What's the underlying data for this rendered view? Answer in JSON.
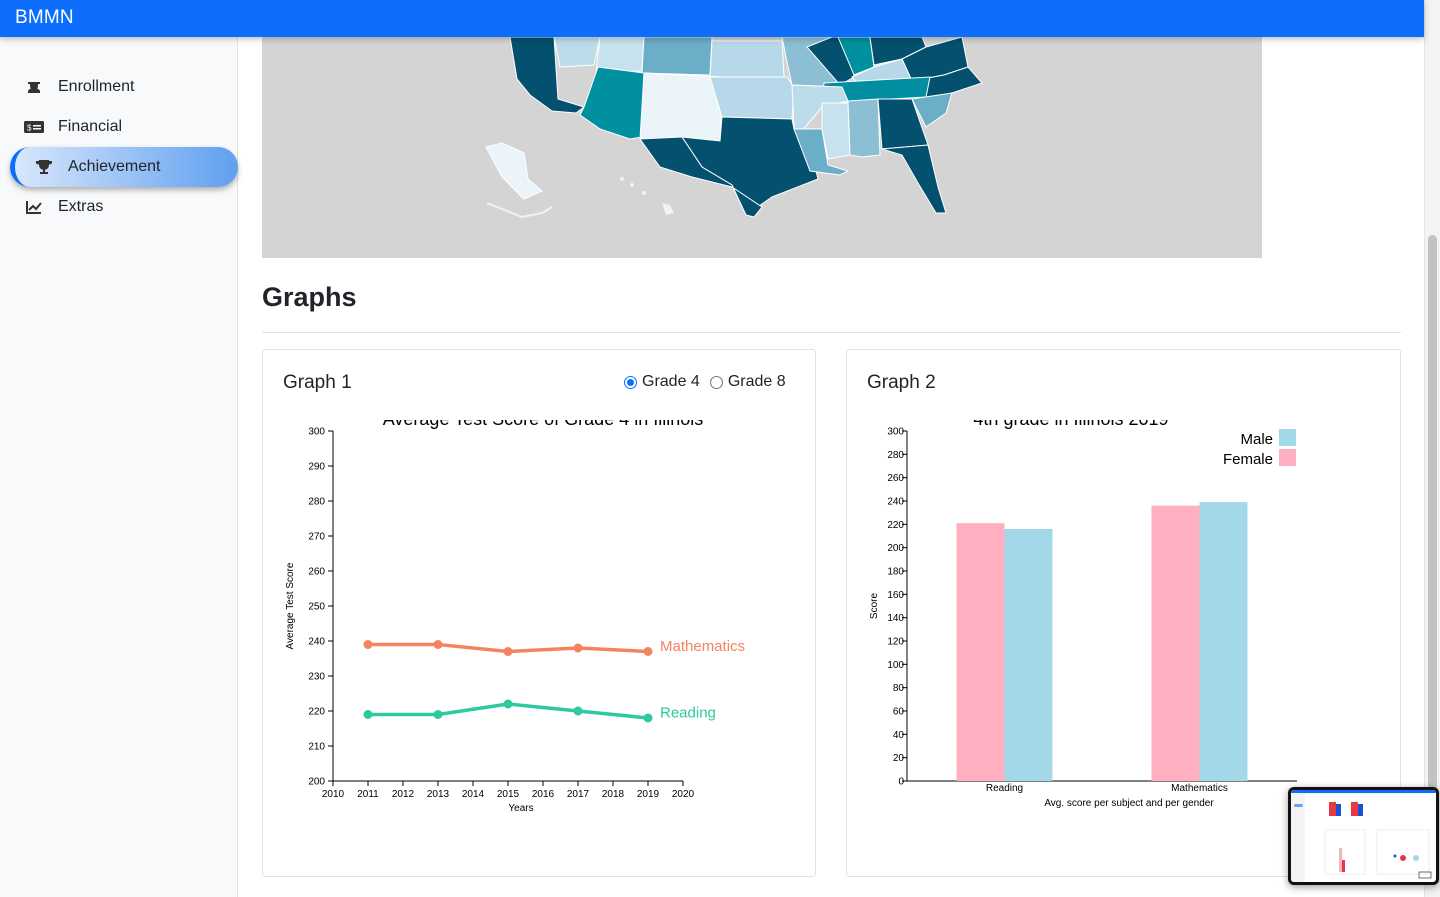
{
  "app": {
    "brand": "BMMN"
  },
  "sidebar": {
    "items": [
      {
        "label": "Enrollment",
        "icon": "graduate-icon",
        "active": false
      },
      {
        "label": "Financial",
        "icon": "money-icon",
        "active": false
      },
      {
        "label": "Achievement",
        "icon": "trophy-icon",
        "active": true
      },
      {
        "label": "Extras",
        "icon": "line-chart-icon",
        "active": false
      }
    ]
  },
  "section": {
    "title": "Graphs"
  },
  "graph1": {
    "card_title": "Graph 1",
    "radio_grade4": "Grade 4",
    "radio_grade8": "Grade 8",
    "selected": "Grade 4"
  },
  "graph2": {
    "card_title": "Graph 2"
  },
  "colors": {
    "primary": "#0d6efd",
    "mathematics": "#f4845f",
    "reading": "#2ec99e",
    "female": "#ffafc0",
    "male": "#a3d8e8"
  },
  "chart_data": [
    {
      "type": "line",
      "title": "Average Test Score of Grade 4 in Illinois",
      "xlabel": "Years",
      "ylabel": "Average Test Score",
      "xlim": [
        2010,
        2020
      ],
      "ylim": [
        200,
        300
      ],
      "xticks": [
        2010,
        2011,
        2012,
        2013,
        2014,
        2015,
        2016,
        2017,
        2018,
        2019,
        2020
      ],
      "yticks": [
        200,
        210,
        220,
        230,
        240,
        250,
        260,
        270,
        280,
        290,
        300
      ],
      "x": [
        2011,
        2013,
        2015,
        2017,
        2019
      ],
      "series": [
        {
          "name": "Mathematics",
          "values": [
            239,
            239,
            237,
            238,
            237
          ],
          "color": "#f4845f"
        },
        {
          "name": "Reading",
          "values": [
            219,
            219,
            222,
            220,
            218
          ],
          "color": "#2ec99e"
        }
      ],
      "grid": false
    },
    {
      "type": "bar",
      "title": "4th grade in Illinois 2019",
      "xlabel": "Avg. score per subject and per gender",
      "ylabel": "Score",
      "categories": [
        "Reading",
        "Mathematics"
      ],
      "ylim": [
        0,
        300
      ],
      "yticks": [
        0,
        20,
        40,
        60,
        80,
        100,
        120,
        140,
        160,
        180,
        200,
        220,
        240,
        260,
        280,
        300
      ],
      "series": [
        {
          "name": "Female",
          "values": [
            221,
            236
          ],
          "color": "#ffafc0"
        },
        {
          "name": "Male",
          "values": [
            216,
            239
          ],
          "color": "#a3d8e8"
        }
      ],
      "legend": "top-right",
      "grid": false
    }
  ]
}
